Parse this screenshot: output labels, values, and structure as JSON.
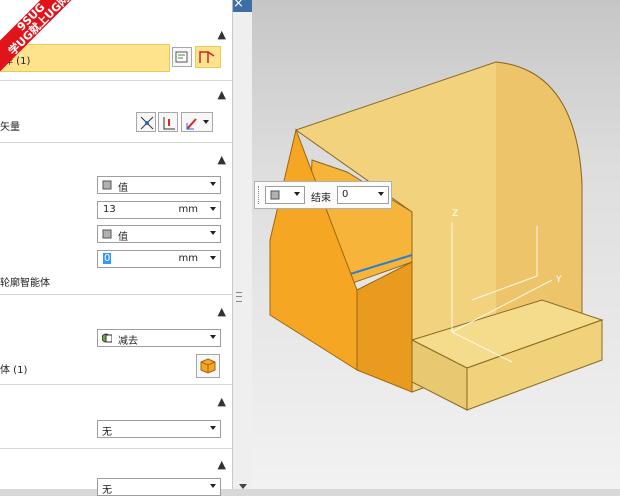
{
  "window": {
    "refresh_icon": "refresh-icon",
    "close_icon": "close-icon",
    "close_glyph": "×"
  },
  "watermark": {
    "line1": "9SUG",
    "line2": "学UG就上UG网"
  },
  "sections": {
    "selection": {
      "field_text": "择 (1)"
    },
    "direction": {
      "label": "矢量"
    },
    "limits": {
      "start_mode": "值",
      "start_value": "13",
      "start_unit": "mm",
      "end_mode": "值",
      "end_value": "0",
      "end_unit": "mm",
      "option_label": "轮廓智能体"
    },
    "boolean": {
      "operation": "减去",
      "body_label": "体 (1)"
    },
    "draft": {
      "value": "无"
    },
    "offset": {
      "value": "无"
    }
  },
  "float_bar": {
    "label": "结束",
    "value": "0"
  },
  "axes": {
    "z": "Z",
    "y": "Y"
  },
  "colors": {
    "accent_yellow": "#ffe28c",
    "model_orange": "#f5a623",
    "title_blue": "#3d6fa6"
  }
}
